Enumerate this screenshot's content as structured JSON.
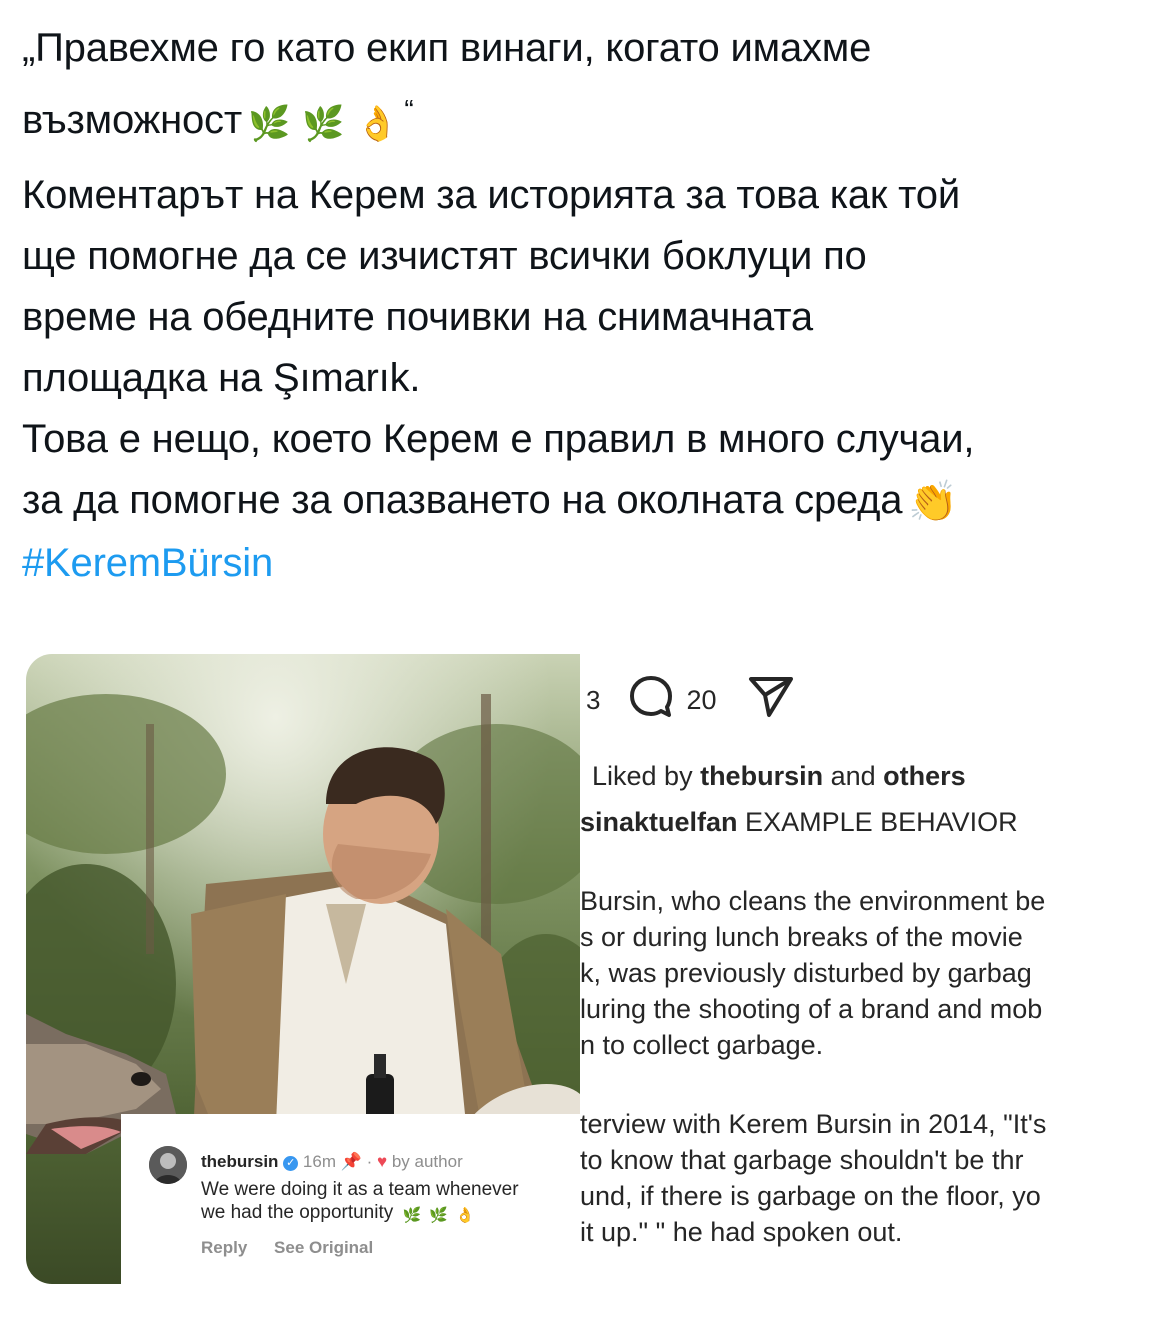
{
  "tweet": {
    "quote_line1": "„Правехме го като екип винаги, когато имахме",
    "quote_line2_text": "възможност",
    "quote_emojis": [
      "🌿",
      "🌿",
      "👌"
    ],
    "quote_close": "“",
    "body_lines": [
      "Коментарът на Керем за историята за това как той",
      "ще помогне да се изчистят всички боклуци по",
      "време на обедните почивки на снимачната",
      "площадка на Şımarık."
    ],
    "body2_line1": "Това е нещо, което Керем е правил в много случаи,",
    "body2_line2": "за да помогне за опазването на околната среда",
    "clap_emoji": "👏",
    "hashtag": "#KeremBürsin"
  },
  "comment_card": {
    "username": "thebursin",
    "verified_icon": "verified-badge-icon",
    "time": "16m",
    "pin_icon": "pin-icon",
    "heart_icon": "heart-icon",
    "by_author": "by author",
    "text_line1": "We were doing it as a team whenever",
    "text_line2": "we had the opportunity",
    "emojis": [
      "🌿",
      "🌿",
      "👌"
    ],
    "reply_label": "Reply",
    "see_original_label": "See Original"
  },
  "instagram": {
    "like_count_partial": "3",
    "comment_count": "20",
    "liked_by_prefix": "Liked by ",
    "liked_by_user": "thebursin",
    "liked_by_mid": " and ",
    "liked_by_others": "others",
    "caption_user_partial": "sinaktuelfan",
    "caption_title": " EXAMPLE BEHAVIOR",
    "para1": [
      "Bursin, who cleans the environment be",
      "s or during lunch breaks of the movie",
      "k, was previously disturbed by garbag",
      "luring the shooting of a brand and mob",
      "n to collect garbage."
    ],
    "para2": [
      "terview with Kerem Bursin in 2014, \"It's",
      " to know that garbage shouldn't be thr",
      "und, if there is garbage on the floor, yo",
      "it up.\" \" he had spoken out."
    ]
  },
  "colors": {
    "hashtag": "#1d9bf0",
    "text": "#0f1419",
    "ig_text": "#262626",
    "ig_secondary": "#8e8e8e",
    "verified": "#3897f0",
    "heart": "#ed4956"
  }
}
